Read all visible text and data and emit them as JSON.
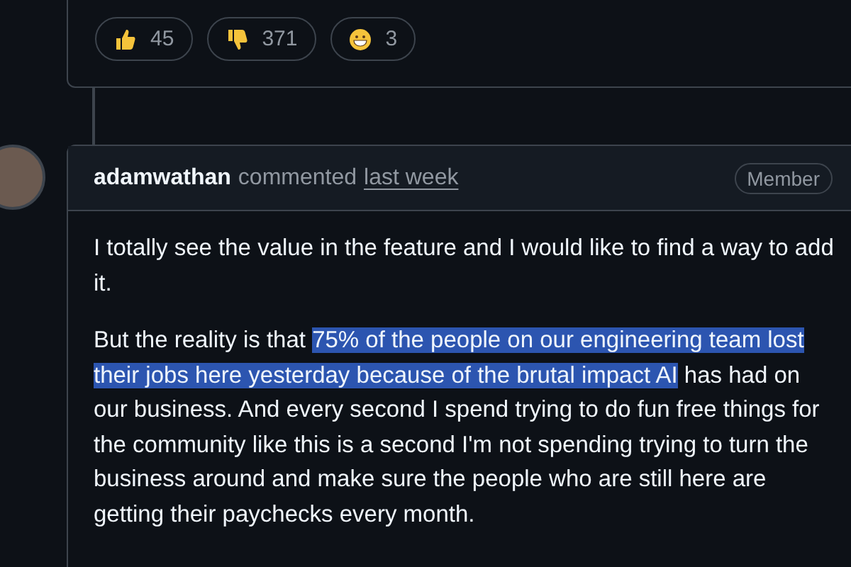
{
  "reactions": [
    {
      "kind": "thumbs-up",
      "count": "45"
    },
    {
      "kind": "thumbs-down",
      "count": "371"
    },
    {
      "kind": "grin",
      "count": "3"
    }
  ],
  "comment": {
    "author": "adamwathan",
    "action": "commented",
    "time": "last week",
    "badge": "Member",
    "paragraphs": [
      [
        {
          "text": "I totally see the value in the feature and I would like to find a way to add it.",
          "highlighted": false
        }
      ],
      [
        {
          "text": "But the reality is that ",
          "highlighted": false
        },
        {
          "text": "75% of the people on our engineering team lost their jobs here yesterday because of the brutal impact AI",
          "highlighted": true
        },
        {
          "text": " has had on our business. And every second I spend trying to do fun free things for the community like this is a second I'm not spending trying to turn the business around and make sure the people who are still here are getting their paychecks every month.",
          "highlighted": false
        }
      ]
    ]
  }
}
